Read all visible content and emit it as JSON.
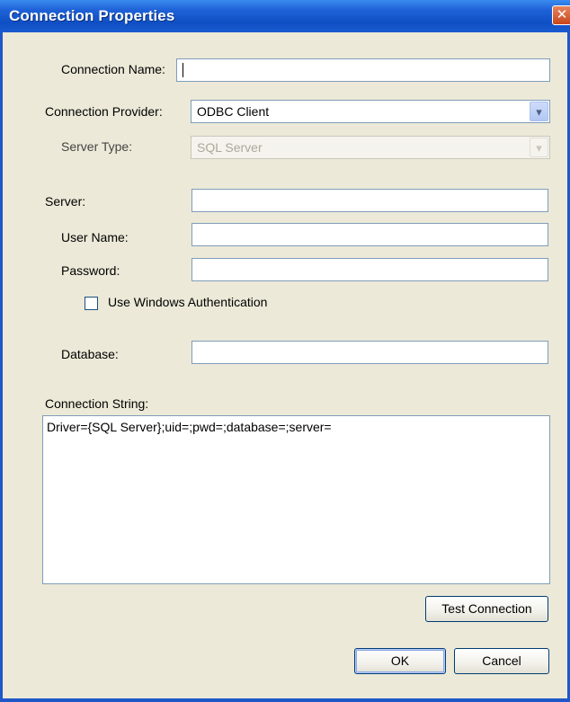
{
  "window": {
    "title": "Connection Properties",
    "close_glyph": "✕",
    "colors": {
      "titlebar": "#1f5ed8",
      "dialog_bg": "#ece9d8",
      "field_border": "#7f9db9"
    }
  },
  "form": {
    "connection_name": {
      "label": "Connection Name:",
      "value": ""
    },
    "connection_provider": {
      "label": "Connection Provider:",
      "value": "ODBC Client"
    },
    "server_type": {
      "label": "Server Type:",
      "value": "SQL Server"
    },
    "server": {
      "label": "Server:",
      "value": ""
    },
    "user_name": {
      "label": "User Name:",
      "value": ""
    },
    "password": {
      "label": "Password:",
      "value": ""
    },
    "windows_auth": {
      "label": "Use Windows Authentication",
      "checked": false
    },
    "database": {
      "label": "Database:",
      "value": ""
    },
    "connection_string": {
      "label": "Connection String:",
      "value": "Driver={SQL Server};uid=;pwd=;database=;server="
    }
  },
  "buttons": {
    "test_connection": "Test Connection",
    "ok": "OK",
    "cancel": "Cancel"
  },
  "icons": {
    "dropdown": "chevron-down-icon",
    "close": "close-icon"
  }
}
